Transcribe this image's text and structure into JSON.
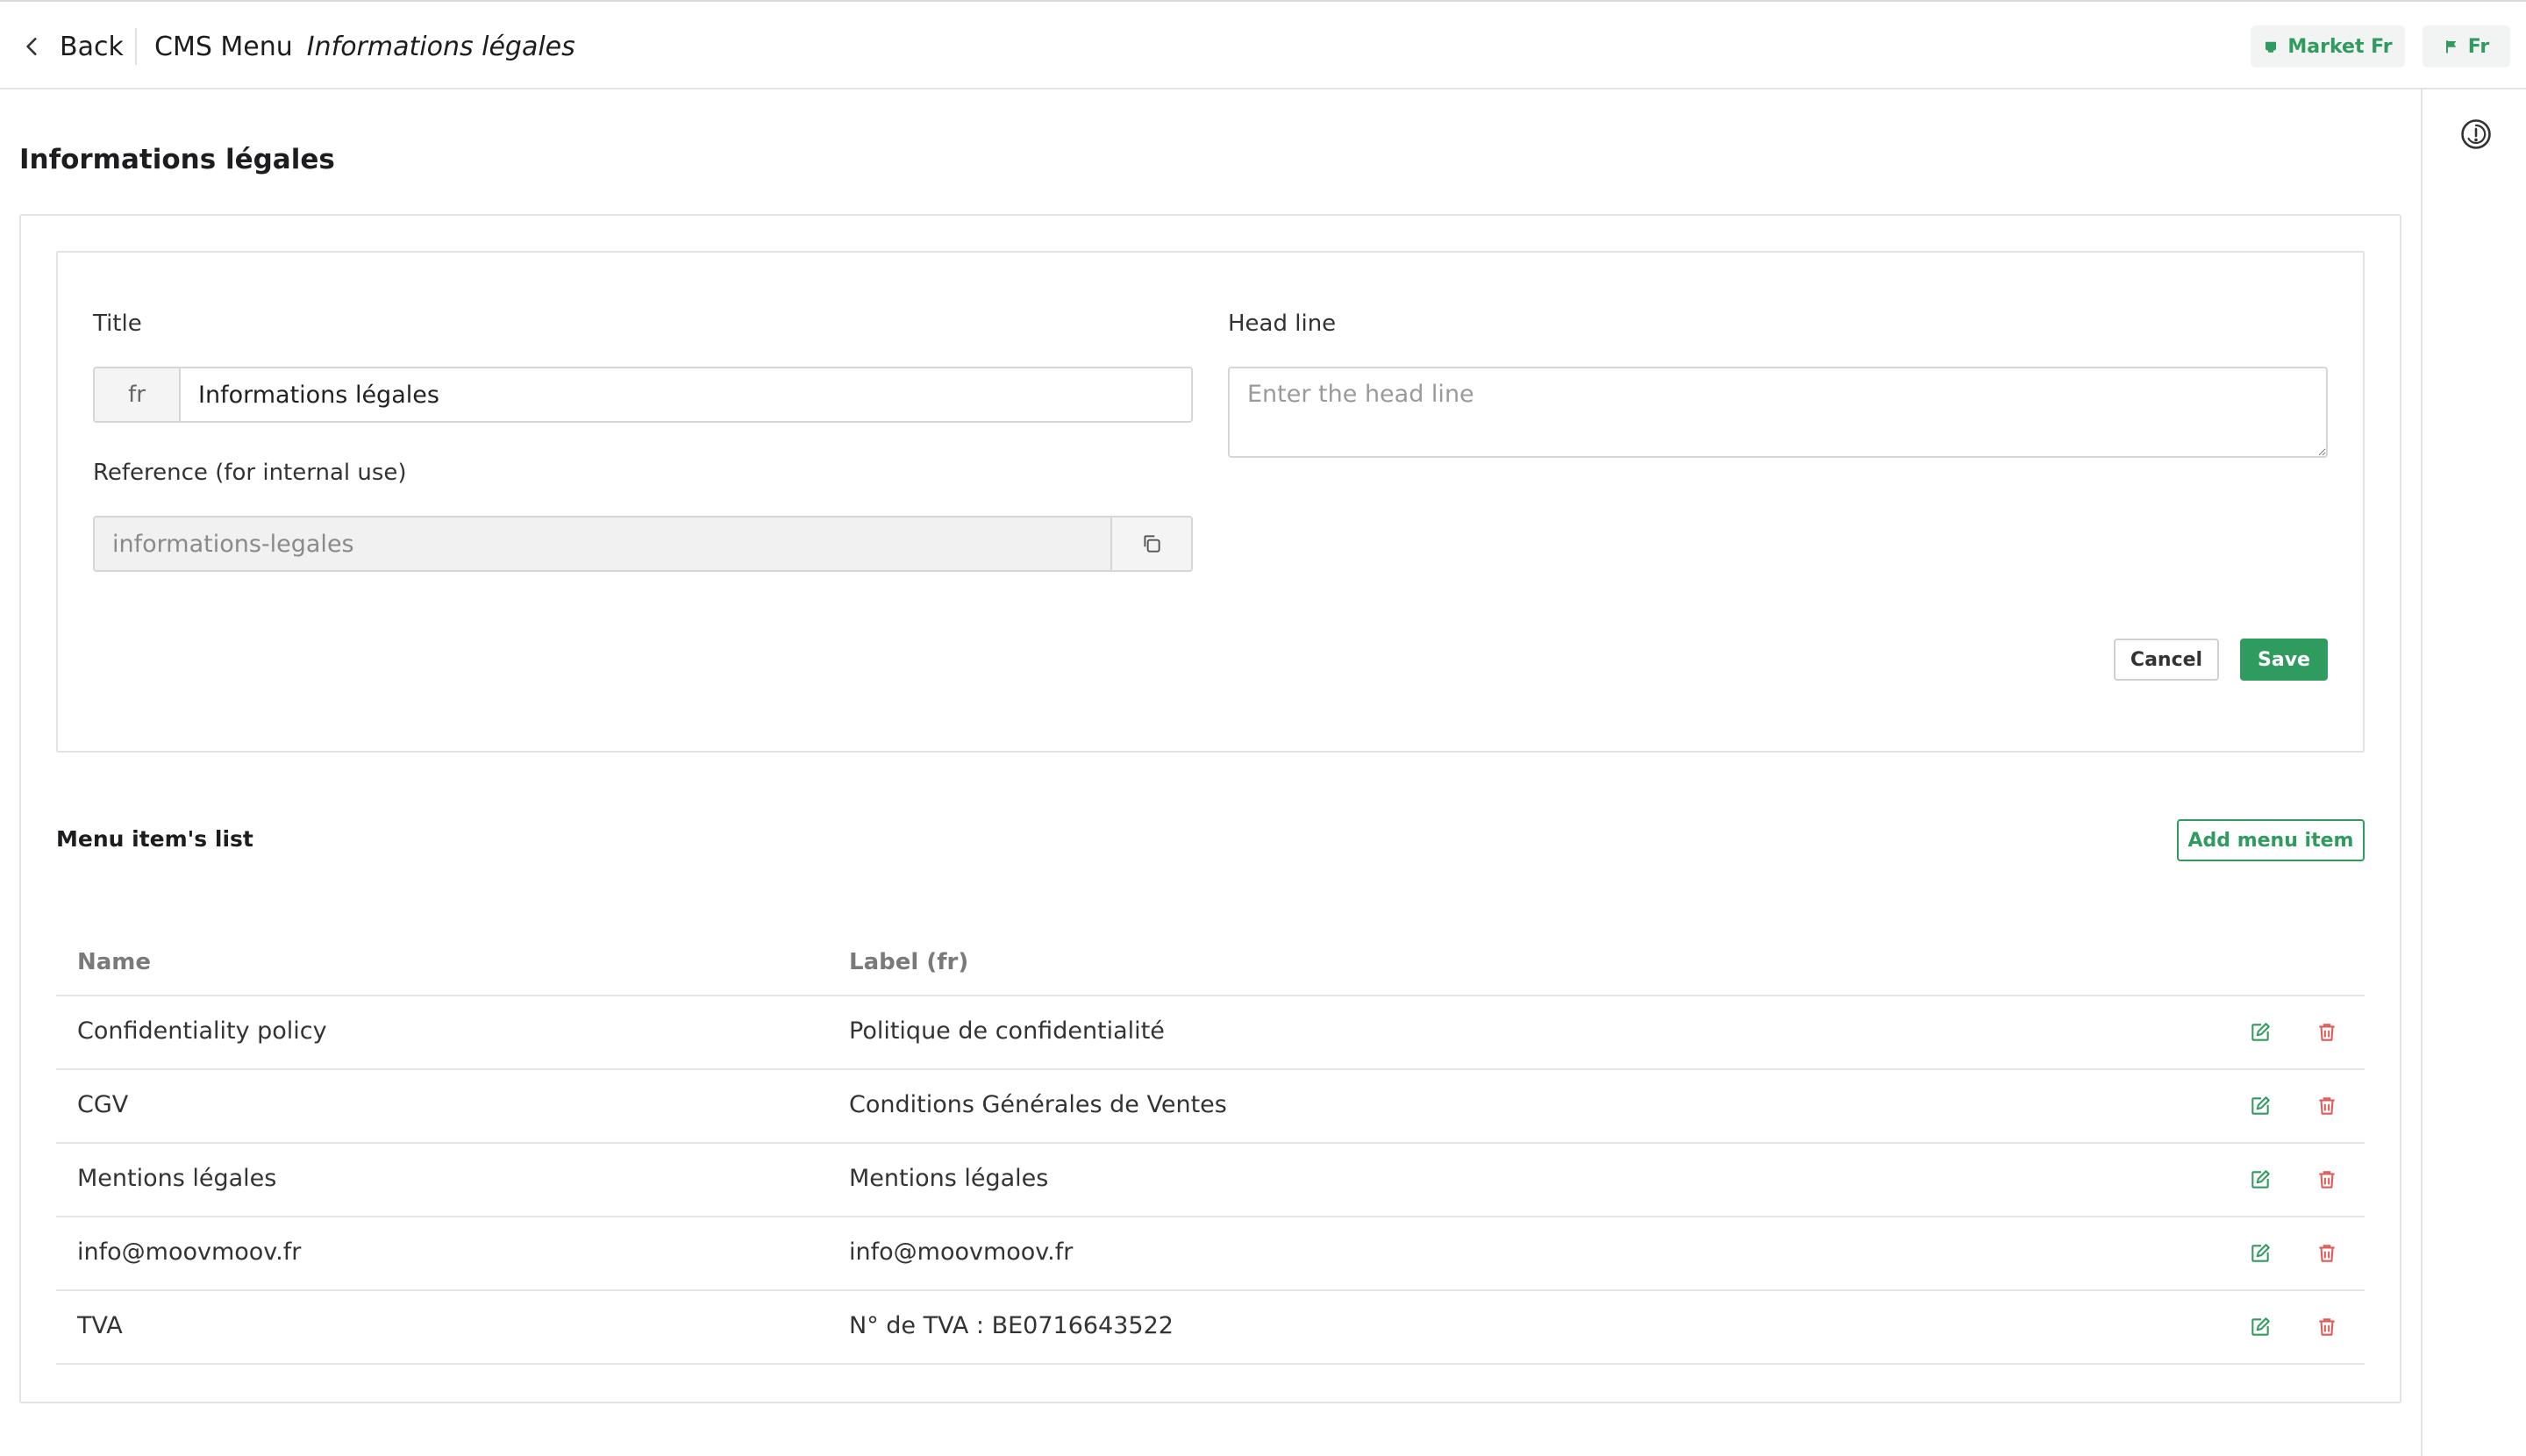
{
  "header": {
    "back_label": "Back",
    "section": "CMS Menu",
    "current": "Informations légales",
    "market_label": "Market Fr",
    "lang_label": "Fr"
  },
  "page": {
    "title": "Informations légales"
  },
  "form": {
    "title_label": "Title",
    "title_lang": "fr",
    "title_value": "Informations légales",
    "headline_label": "Head line",
    "headline_placeholder": "Enter the head line",
    "reference_label": "Reference (for internal use)",
    "reference_value": "informations-legales",
    "cancel_label": "Cancel",
    "save_label": "Save"
  },
  "menu_items": {
    "section_title": "Menu item's list",
    "add_label": "Add menu item",
    "columns": [
      "Name",
      "Label (fr)"
    ],
    "rows": [
      {
        "name": "Confidentiality policy",
        "label": "Politique de confidentialité"
      },
      {
        "name": "CGV",
        "label": "Conditions Générales de Ventes"
      },
      {
        "name": "Mentions légales",
        "label": "Mentions légales"
      },
      {
        "name": "info@moovmoov.fr",
        "label": "info@moovmoov.fr"
      },
      {
        "name": "TVA",
        "label": "N° de TVA : BE0716643522"
      }
    ]
  },
  "colors": {
    "accent": "#2f9b5e",
    "danger": "#e05a5a"
  },
  "icons": {
    "back": "chevron-left-icon",
    "market": "store-icon",
    "lang": "flag-icon",
    "rail": "help-circle-icon",
    "copy": "copy-icon",
    "edit": "edit-icon",
    "delete": "trash-icon"
  }
}
